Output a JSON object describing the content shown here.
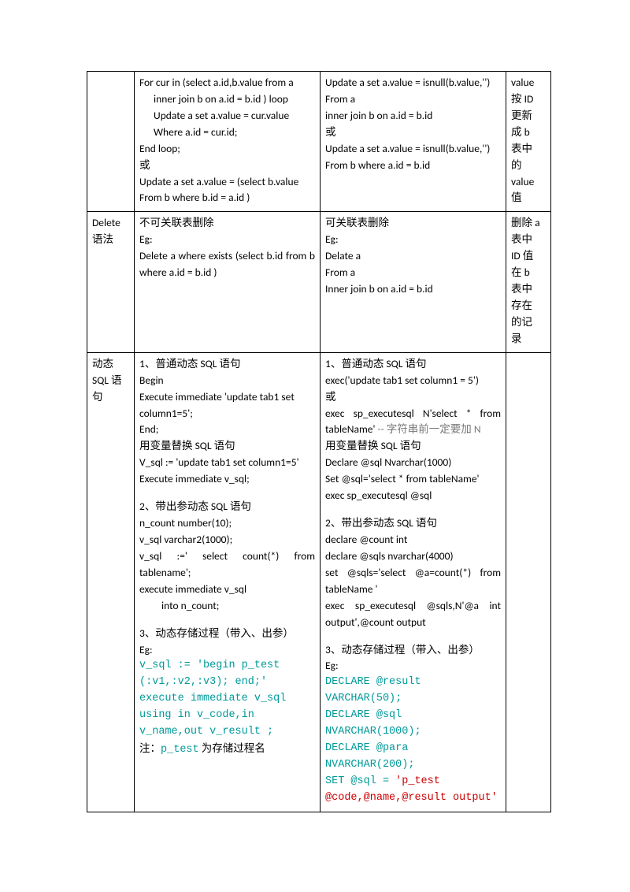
{
  "rows": [
    {
      "c1": "",
      "c2_lines": [
        {
          "t": "For cur in (select a.id,b.value from a"
        },
        {
          "t": "inner join b on a.id = b.id ) loop",
          "cls": "indent"
        },
        {
          "t": "Update a set a.value = cur.value",
          "cls": "indent"
        },
        {
          "t": "Where a.id = cur.id;",
          "cls": "indent"
        },
        {
          "t": "End loop;"
        },
        {
          "t": "或"
        },
        {
          "t": "Update a set a.value = (select b.value"
        },
        {
          "t": "From b where b.id = a.id )"
        }
      ],
      "c3_lines": [
        {
          "t": "Update a set a.value = isnull(b.value,'')"
        },
        {
          "t": "From a"
        },
        {
          "t": "inner join b on a.id = b.id"
        },
        {
          "t": ""
        },
        {
          "t": "或"
        },
        {
          "t": "Update a set a.value = isnull(b.value,'')"
        },
        {
          "t": "From b where a.id = b.id"
        }
      ],
      "c4_lines": [
        "value",
        "按 ID",
        "更新",
        "成 b",
        "表中",
        "的",
        "value",
        "值"
      ]
    },
    {
      "c1": "Delete\n语法",
      "c2_lines": [
        {
          "t": "不可关联表删除"
        },
        {
          "t": "Eg:"
        },
        {
          "t": "Delete a where exists (select b.id from b where a.id = b.id )",
          "cls": "just"
        }
      ],
      "c3_lines": [
        {
          "t": "可关联表删除"
        },
        {
          "t": "Eg:"
        },
        {
          "t": "Delate a"
        },
        {
          "t": "From a"
        },
        {
          "t": "Inner join b on a.id = b.id"
        }
      ],
      "c4_lines": [
        "删除 a",
        "表中",
        "ID 值",
        "在 b",
        "表中",
        "存在",
        "的记",
        "录"
      ]
    },
    {
      "c1": "动态\nSQL 语\n句",
      "c2_lines": [
        {
          "t": "1、普通动态 SQL 语句"
        },
        {
          "t": "Begin"
        },
        {
          "t": "Execute immediate 'update tab1 set column1=5';"
        },
        {
          "t": "End;"
        },
        {
          "t": "用变量替换 SQL 语句"
        },
        {
          "t": "V_sql := 'update tab1 set column1=5'"
        },
        {
          "t": "Execute immediate v_sql;"
        },
        {
          "t": "",
          "cls": "spacer"
        },
        {
          "t": "2、带出参动态 SQL 语句"
        },
        {
          "t": "n_count number(10);"
        },
        {
          "t": "v_sql varchar2(1000);"
        },
        {
          "t": "v_sql :=' select count(*) from tablename';",
          "cls": "just"
        },
        {
          "t": "execute immediate v_sql"
        },
        {
          "t": "into n_count;",
          "cls": "indent2"
        },
        {
          "t": "",
          "cls": "spacer"
        },
        {
          "t": "3、动态存储过程（带入、出参）"
        },
        {
          "t": "Eg:"
        },
        {
          "t": "v_sql := 'begin  p_test",
          "cls": "mono green"
        },
        {
          "t": "(:v1,:v2,:v3); end;'",
          "cls": "mono green"
        },
        {
          "t": "execute immediate v_sql",
          "cls": "mono green"
        },
        {
          "t": " using in v_code,in",
          "cls": "mono green"
        },
        {
          "t": "v_name,out v_result ;",
          "cls": "mono green"
        },
        {
          "html": "<span>注：</span><span class=\"mono green\">p_test</span><span> 为存储过程名</span>"
        }
      ],
      "c3_lines": [
        {
          "t": "1、普通动态 SQL 语句"
        },
        {
          "t": "exec('update tab1 set column1 = 5')"
        },
        {
          "t": "或"
        },
        {
          "html": "exec sp_executesql N'select * from tableName' <span class=\"gray\">-- 字符串前一定要加 N</span>",
          "cls": "just"
        },
        {
          "t": "用变量替换 SQL 语句"
        },
        {
          "t": "Declare @sql Nvarchar(1000)"
        },
        {
          "t": "Set @sql='select * from tableName'"
        },
        {
          "t": "exec sp_executesql @sql"
        },
        {
          "t": "",
          "cls": "spacer"
        },
        {
          "t": "2、带出参动态 SQL 语句"
        },
        {
          "t": "declare @count int"
        },
        {
          "t": "declare @sqls nvarchar(4000)"
        },
        {
          "t": "set @sqls='select @a=count(*) from tableName '",
          "cls": "just"
        },
        {
          "t": "exec sp_executesql @sqls,N'@a int output',@count output",
          "cls": "just"
        },
        {
          "t": "",
          "cls": "spacer"
        },
        {
          "t": "3、动态存储过程（带入、出参）"
        },
        {
          "t": "Eg:"
        },
        {
          "t": "DECLARE @result",
          "cls": "mono green"
        },
        {
          "t": "VARCHAR(50);",
          "cls": "mono green"
        },
        {
          "t": "DECLARE @sql",
          "cls": "mono green"
        },
        {
          "t": "NVARCHAR(1000);",
          "cls": "mono green"
        },
        {
          "t": "DECLARE @para",
          "cls": "mono green"
        },
        {
          "t": "NVARCHAR(200);",
          "cls": "mono green"
        },
        {
          "html": "<span class=\"green\">SET @sql = </span><span class=\"red\">'p_test</span>",
          "cls": "mono"
        },
        {
          "t": "@code,@name,@result output'",
          "cls": "mono red"
        }
      ],
      "c4_lines": []
    }
  ]
}
